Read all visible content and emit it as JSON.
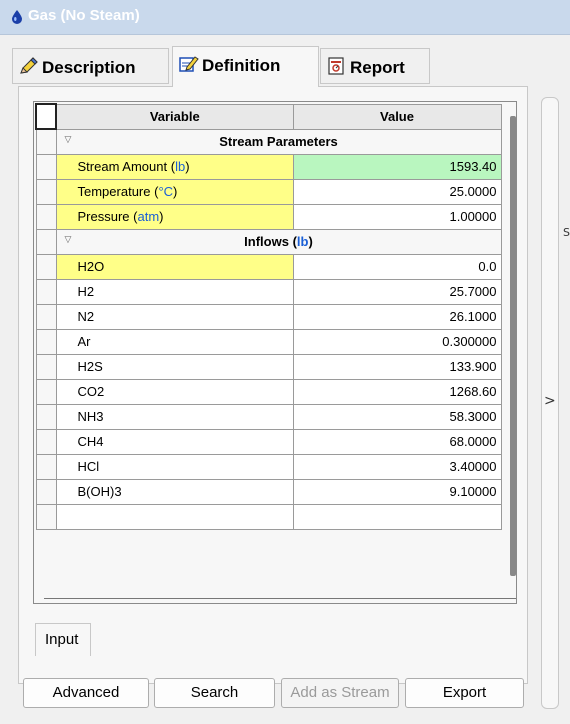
{
  "window": {
    "title": "Gas (No Steam)",
    "icon": "drop-icon"
  },
  "tabs": [
    {
      "label": "Description",
      "icon": "pencil-icon"
    },
    {
      "label": "Definition",
      "icon": "edit-icon"
    },
    {
      "label": "Report",
      "icon": "report-icon"
    }
  ],
  "grid": {
    "headers": {
      "variable": "Variable",
      "value": "Value"
    },
    "stream_section": "Stream Parameters",
    "stream_rows": [
      {
        "name": "Stream Amount",
        "unit": "lb",
        "value": "1593.40"
      },
      {
        "name": "Temperature",
        "unit": "°C",
        "value": "25.0000"
      },
      {
        "name": "Pressure",
        "unit": "atm",
        "value": "1.00000"
      }
    ],
    "inflows_section": {
      "label": "Inflows",
      "unit": "lb"
    },
    "inflow_rows": [
      {
        "name": "H2O",
        "value": "0.0"
      },
      {
        "name": "H2",
        "value": "25.7000"
      },
      {
        "name": "N2",
        "value": "26.1000"
      },
      {
        "name": "Ar",
        "value": "0.300000"
      },
      {
        "name": "H2S",
        "value": "133.900"
      },
      {
        "name": "CO2",
        "value": "1268.60"
      },
      {
        "name": "NH3",
        "value": "58.3000"
      },
      {
        "name": "CH4",
        "value": "68.0000"
      },
      {
        "name": "HCl",
        "value": "3.40000"
      },
      {
        "name": "B(OH)3",
        "value": "9.10000"
      }
    ]
  },
  "bottom_tab": "Input",
  "buttons": {
    "advanced": "Advanced",
    "search": "Search",
    "add_as_stream": "Add as Stream",
    "export": "Export"
  },
  "right_panel": {
    "chevron": ">",
    "edge_text": "S"
  },
  "colors": {
    "title_bg": "#c9d9ec",
    "required": "#ffff88",
    "computed": "#b9f6bf",
    "unit": "#1a5fd6"
  }
}
